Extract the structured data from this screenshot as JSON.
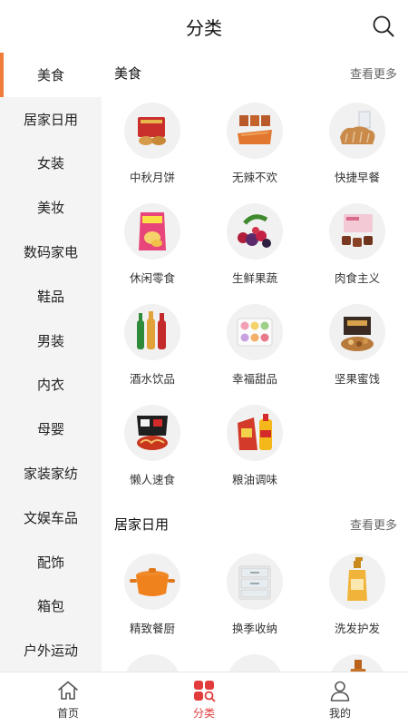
{
  "header": {
    "title": "分类"
  },
  "sidebar": {
    "items": [
      {
        "label": "美食"
      },
      {
        "label": "居家日用"
      },
      {
        "label": "女装"
      },
      {
        "label": "美妆"
      },
      {
        "label": "数码家电"
      },
      {
        "label": "鞋品"
      },
      {
        "label": "男装"
      },
      {
        "label": "内衣"
      },
      {
        "label": "母婴"
      },
      {
        "label": "家装家纺"
      },
      {
        "label": "文娱车品"
      },
      {
        "label": "配饰"
      },
      {
        "label": "箱包"
      },
      {
        "label": "户外运动"
      }
    ],
    "active_index": 0
  },
  "sections": [
    {
      "title": "美食",
      "more": "查看更多",
      "items": [
        {
          "label": "中秋月饼",
          "icon": "mooncake-icon"
        },
        {
          "label": "无辣不欢",
          "icon": "spicy-snack-icon"
        },
        {
          "label": "快捷早餐",
          "icon": "bread-icon"
        },
        {
          "label": "休闲零食",
          "icon": "chips-icon"
        },
        {
          "label": "生鲜果蔬",
          "icon": "fruit-icon"
        },
        {
          "label": "肉食主义",
          "icon": "meat-icon"
        },
        {
          "label": "酒水饮品",
          "icon": "drinks-icon"
        },
        {
          "label": "幸福甜品",
          "icon": "macaron-icon"
        },
        {
          "label": "坚果蜜饯",
          "icon": "nuts-icon"
        },
        {
          "label": "懒人速食",
          "icon": "instant-noodle-icon"
        },
        {
          "label": "粮油调味",
          "icon": "oil-rice-icon"
        }
      ]
    },
    {
      "title": "居家日用",
      "more": "查看更多",
      "items": [
        {
          "label": "精致餐厨",
          "icon": "pot-icon"
        },
        {
          "label": "换季收纳",
          "icon": "storage-box-icon"
        },
        {
          "label": "洗发护发",
          "icon": "shampoo-icon"
        }
      ]
    }
  ],
  "tabbar": {
    "items": [
      {
        "label": "首页",
        "icon": "home-icon"
      },
      {
        "label": "分类",
        "icon": "category-icon"
      },
      {
        "label": "我的",
        "icon": "user-icon"
      }
    ],
    "active_index": 1
  },
  "colors": {
    "accent": "#f07c3a",
    "tab_active": "#e23b3b"
  }
}
